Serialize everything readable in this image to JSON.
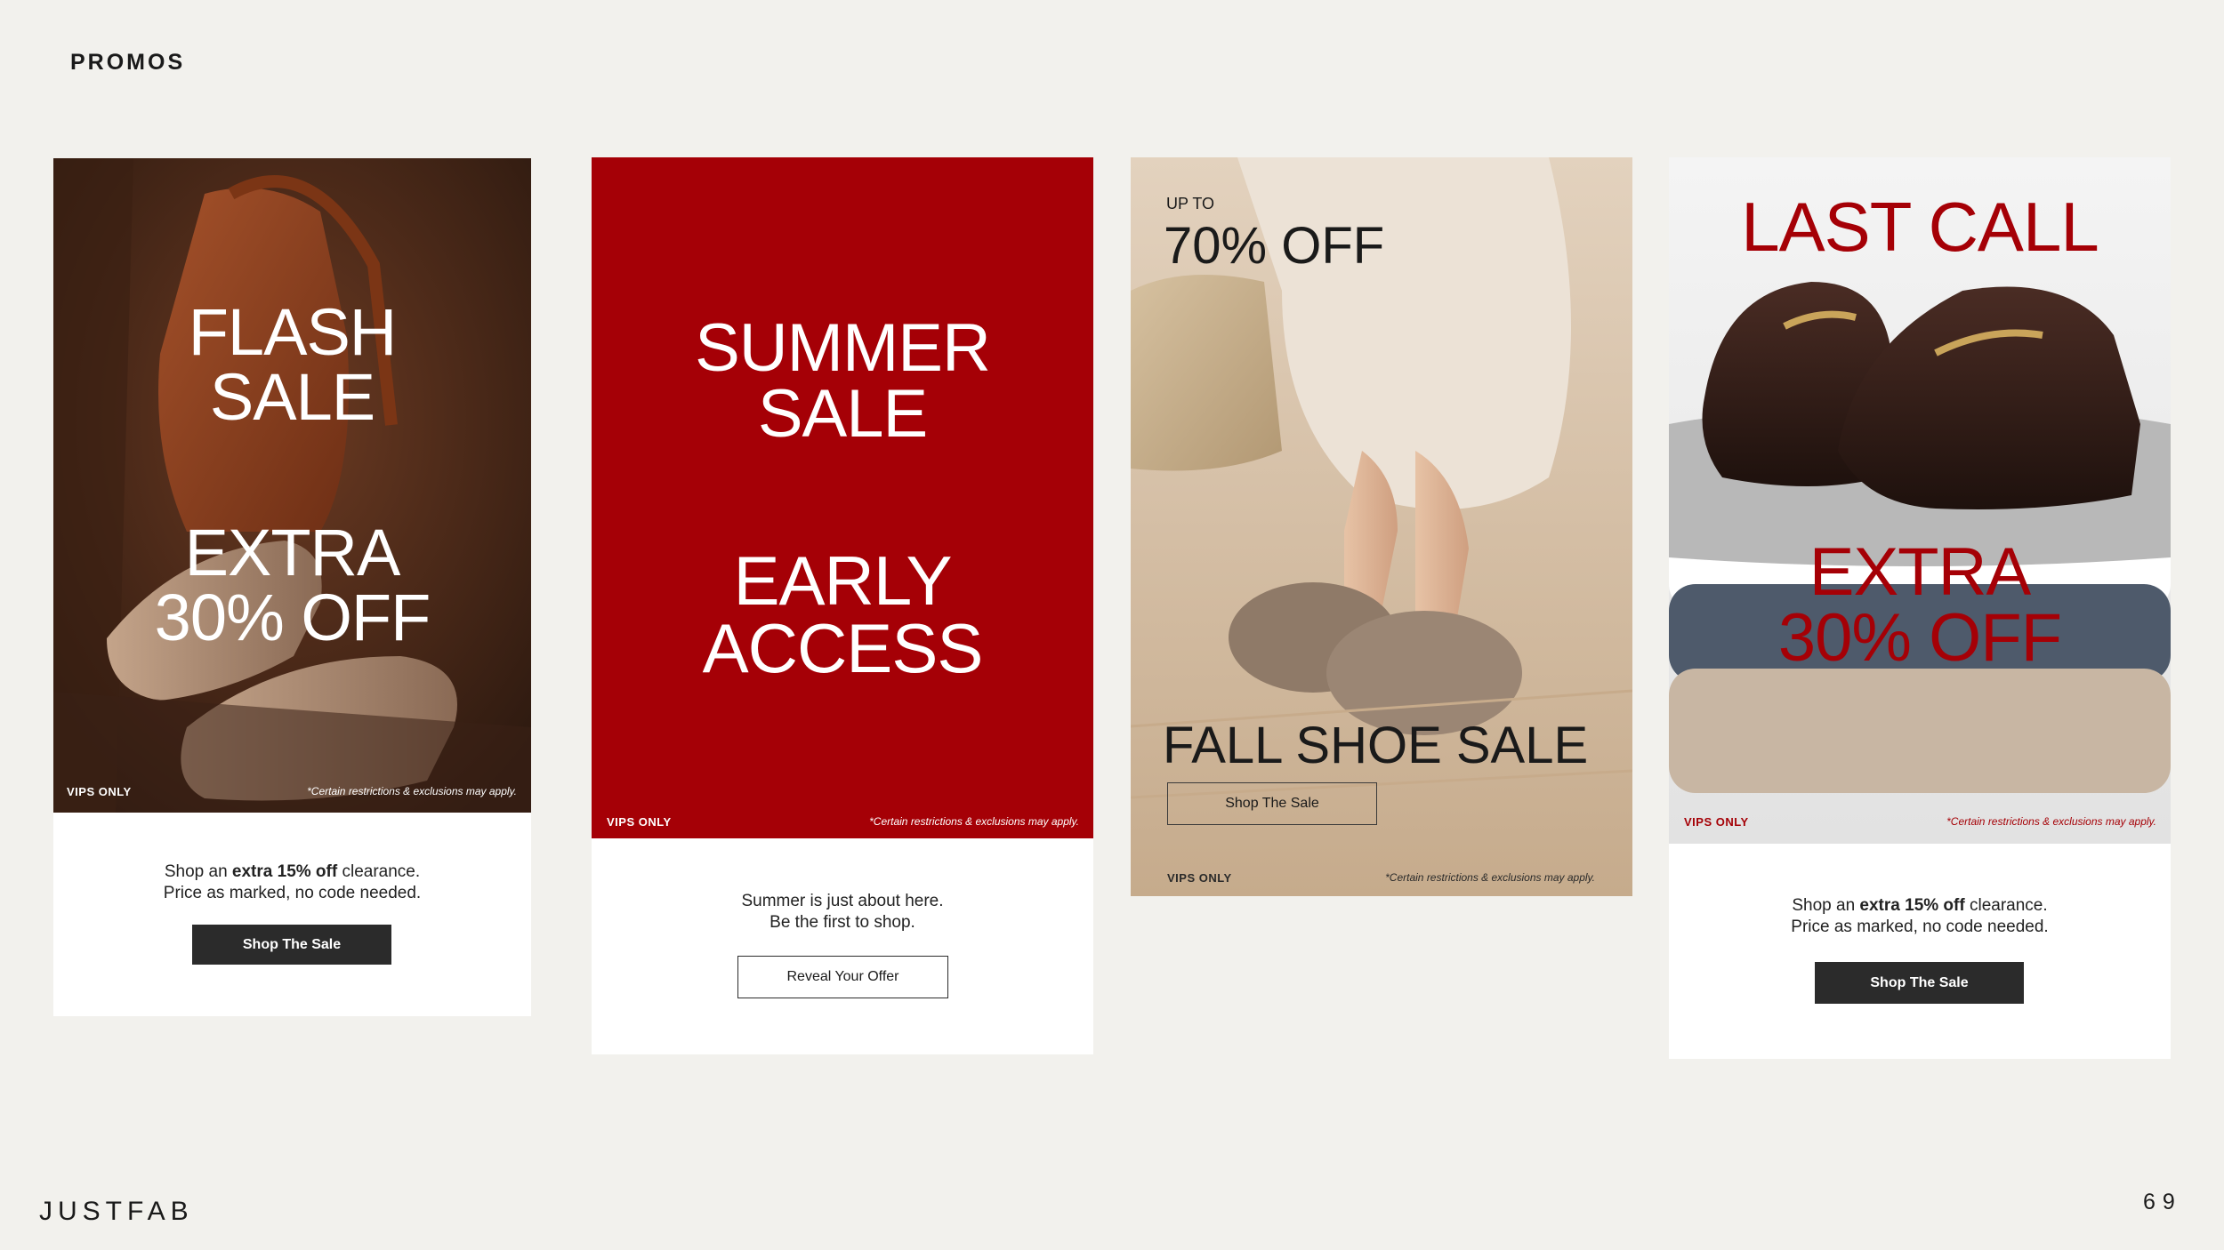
{
  "header": {
    "section_title": "PROMOS"
  },
  "footer": {
    "brand": "JUSTFAB",
    "page_number": "69"
  },
  "cards": [
    {
      "headline_top": [
        "FLASH",
        "SALE"
      ],
      "headline_bottom": [
        "EXTRA",
        "30% OFF"
      ],
      "vip_label": "VIPS ONLY",
      "disclaimer": "*Certain restrictions & exclusions may apply.",
      "copy_line1_pre": "Shop an ",
      "copy_line1_bold": "extra 15% off",
      "copy_line1_post": " clearance.",
      "copy_line2": "Price as marked, no code needed.",
      "button": "Shop The Sale"
    },
    {
      "headline_top": [
        "SUMMER",
        "SALE"
      ],
      "headline_bottom": [
        "EARLY",
        "ACCESS"
      ],
      "vip_label": "VIPS ONLY",
      "disclaimer": "*Certain restrictions & exclusions may apply.",
      "copy_line1": "Summer is just about here.",
      "copy_line2": "Be the first to shop.",
      "button": "Reveal Your Offer"
    },
    {
      "kicker": "UP TO",
      "headline_top": "70% OFF",
      "headline_bottom": "FALL SHOE SALE",
      "button": "Shop The Sale",
      "vip_label": "VIPS ONLY",
      "disclaimer": "*Certain restrictions & exclusions may apply."
    },
    {
      "headline_top": "LAST CALL",
      "headline_bottom": [
        "EXTRA",
        "30% OFF"
      ],
      "vip_label": "VIPS ONLY",
      "disclaimer": "*Certain restrictions & exclusions may apply.",
      "copy_line1_pre": "Shop an ",
      "copy_line1_bold": "extra 15% off",
      "copy_line1_post": " clearance.",
      "copy_line2": "Price as marked, no code needed.",
      "button": "Shop The Sale"
    }
  ],
  "colors": {
    "page_bg": "#f2f1ed",
    "accent_red": "#a50006",
    "dark_button": "#2b2b2b"
  }
}
